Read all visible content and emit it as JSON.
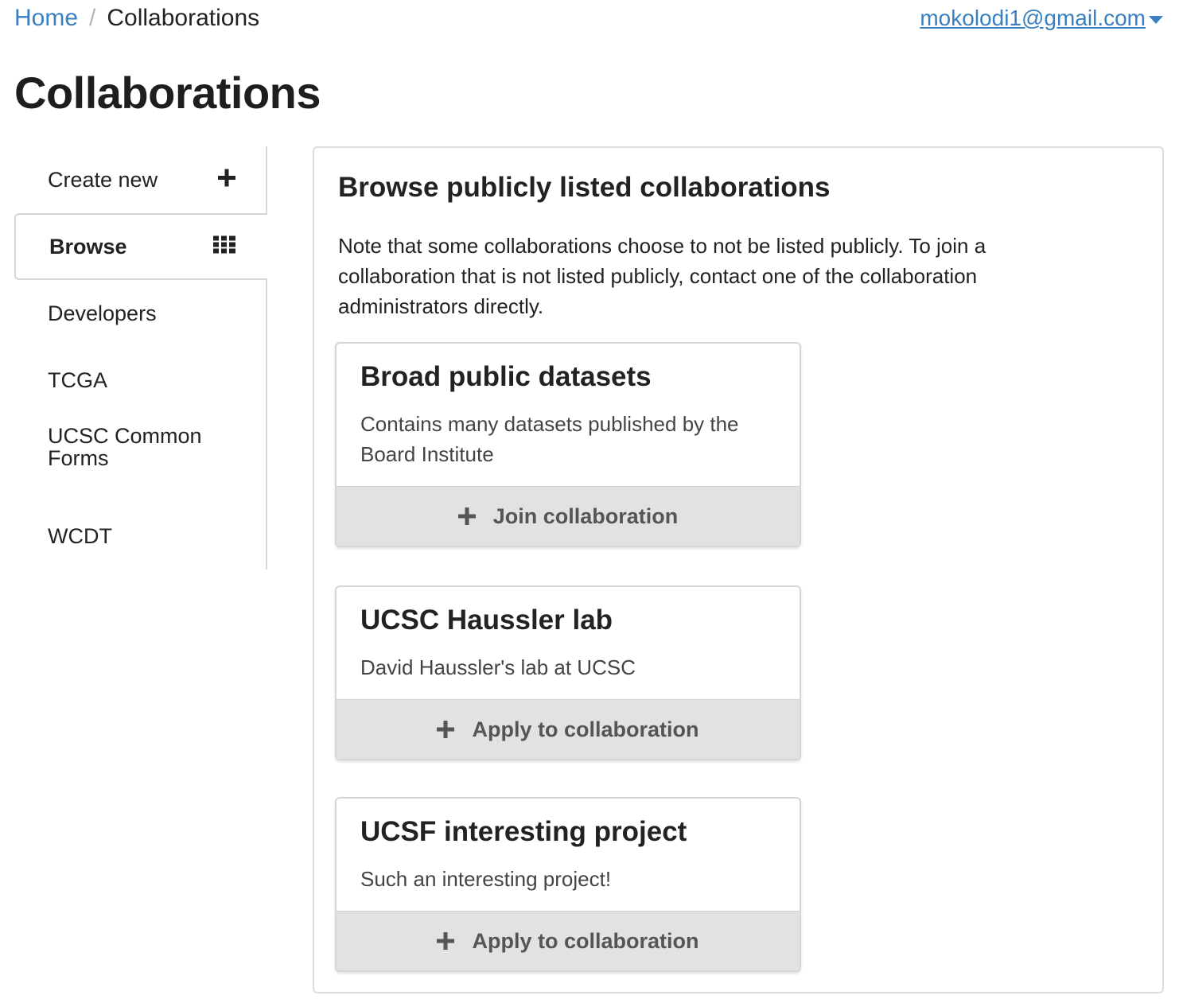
{
  "breadcrumb": {
    "home": "Home",
    "separator": "/",
    "current": "Collaborations"
  },
  "user": {
    "email": "mokolodi1@gmail.com"
  },
  "page": {
    "title": "Collaborations"
  },
  "sidebar": {
    "items": [
      {
        "label": "Create new",
        "icon": "plus-icon"
      },
      {
        "label": "Browse",
        "icon": "grid-icon",
        "active": true
      },
      {
        "label": "Developers"
      },
      {
        "label": "TCGA"
      },
      {
        "label": "UCSC Common Forms"
      },
      {
        "label": "WCDT"
      }
    ]
  },
  "main": {
    "heading": "Browse publicly listed collaborations",
    "note": "Note that some collaborations choose to not be listed publicly. To join a collaboration that is not listed publicly, contact one of the collaboration administrators directly.",
    "cards": [
      {
        "title": "Broad public datasets",
        "description": "Contains many datasets published by the Board Institute",
        "action": "Join collaboration"
      },
      {
        "title": "UCSC Haussler lab",
        "description": "David Haussler's lab at UCSC",
        "action": "Apply to collaboration"
      },
      {
        "title": "UCSF interesting project",
        "description": "Such an interesting project!",
        "action": "Apply to collaboration"
      }
    ]
  },
  "colors": {
    "link": "#3a7fc0",
    "action_bg": "#e2e2e3",
    "border": "#dddddd"
  }
}
